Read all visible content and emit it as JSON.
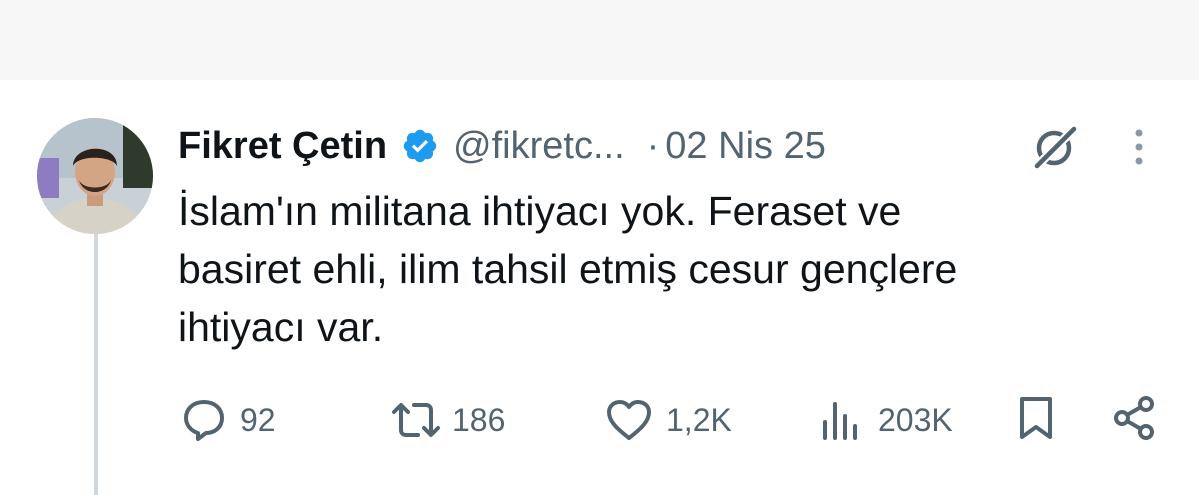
{
  "author": {
    "display_name": "Fikret Çetin",
    "handle": "@fikretc...",
    "separator": "·",
    "date": "02 Nis 25",
    "verified": true,
    "badge_color": "#1d9bf0"
  },
  "tweet": {
    "lines": [
      "İslam'ın militana ihtiyacı yok. Feraset ve",
      "basiret ehli, ilim tahsil etmiş cesur gençlere",
      "ihtiyacı var."
    ]
  },
  "actions": {
    "replies": "92",
    "reposts": "186",
    "likes": "1,2K",
    "views": "203K"
  },
  "icons": {
    "header": [
      "verified-badge-icon",
      "grok-icon",
      "more-options-icon"
    ],
    "actions": [
      "reply-icon",
      "repost-icon",
      "like-icon",
      "views-icon",
      "bookmark-icon",
      "share-icon"
    ]
  },
  "colors": {
    "text": "#0f1419",
    "secondary": "#536471",
    "thread_line": "#cfd9de"
  }
}
